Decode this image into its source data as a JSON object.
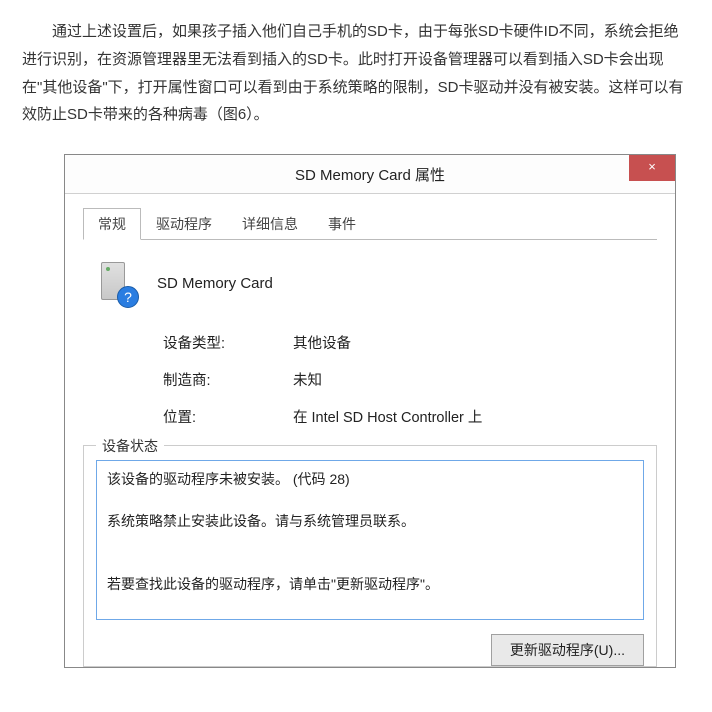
{
  "article": {
    "paragraph": "通过上述设置后，如果孩子插入他们自己手机的SD卡，由于每张SD卡硬件ID不同，系统会拒绝进行识别，在资源管理器里无法看到插入的SD卡。此时打开设备管理器可以看到插入SD卡会出现在\"其他设备\"下，打开属性窗口可以看到由于系统策略的限制，SD卡驱动并没有被安装。这样可以有效防止SD卡带来的各种病毒（图6）。"
  },
  "dialog": {
    "title": "SD Memory Card 属性",
    "close": "×",
    "tabs": {
      "general": "常规",
      "driver": "驱动程序",
      "details": "详细信息",
      "events": "事件"
    },
    "device_name": "SD Memory Card",
    "qmark": "?",
    "info": {
      "type_label": "设备类型:",
      "type_value": "其他设备",
      "mfr_label": "制造商:",
      "mfr_value": "未知",
      "loc_label": "位置:",
      "loc_value": "在 Intel SD Host Controller 上"
    },
    "status": {
      "legend": "设备状态",
      "text": "该设备的驱动程序未被安装。 (代码 28)\n\n系统策略禁止安装此设备。请与系统管理员联系。\n\n\n若要查找此设备的驱动程序，请单击\"更新驱动程序\"。"
    },
    "update_btn": "更新驱动程序(U)..."
  }
}
